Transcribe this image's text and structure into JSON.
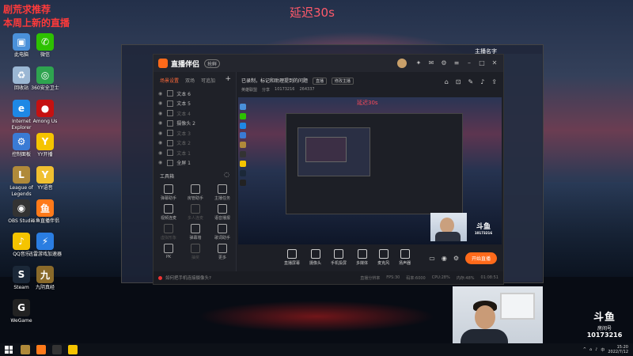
{
  "overlay": {
    "delay_title": "延迟30s",
    "top_left_line1": "剧荒求推荐",
    "top_left_line2": "本周上新的直播"
  },
  "desktop_icons": [
    {
      "label": "此电脑",
      "icon": "computer-icon",
      "color": "#4a90d9",
      "glyph": "▣"
    },
    {
      "label": "回收站",
      "icon": "recycle-bin-icon",
      "color": "#9bb7d4",
      "glyph": "♻"
    },
    {
      "label": "Internet Explorer",
      "icon": "ie-icon",
      "color": "#1e88e5",
      "glyph": "e"
    },
    {
      "label": "控制面板",
      "icon": "control-panel-icon",
      "color": "#3a7bd5",
      "glyph": "⚙"
    },
    {
      "label": "League of Legends",
      "icon": "lol-icon",
      "color": "#b08a3a",
      "glyph": "L"
    },
    {
      "label": "OBS Studio",
      "icon": "obs-icon",
      "color": "#333",
      "glyph": "◉"
    },
    {
      "label": "QQ音乐",
      "icon": "qq-music-icon",
      "color": "#f5c400",
      "glyph": "♪"
    },
    {
      "label": "Steam",
      "icon": "steam-icon",
      "color": "#1b2838",
      "glyph": "S"
    },
    {
      "label": "WeGame",
      "icon": "wegame-icon",
      "color": "#222",
      "glyph": "G"
    },
    {
      "label": "微信",
      "icon": "wechat-icon",
      "color": "#2dc100",
      "glyph": "✆"
    },
    {
      "label": "360安全卫士",
      "icon": "security-icon",
      "color": "#2ea44f",
      "glyph": "◎"
    },
    {
      "label": "Among Us",
      "icon": "among-us-icon",
      "color": "#c51111",
      "glyph": "●"
    },
    {
      "label": "YY开播",
      "icon": "yy-icon",
      "color": "#f5c400",
      "glyph": "Y"
    },
    {
      "label": "YY语音",
      "icon": "yy-voice-icon",
      "color": "#f0c030",
      "glyph": "Y"
    },
    {
      "label": "斗鱼直播伴侣",
      "icon": "douyu-icon",
      "color": "#ff7a1a",
      "glyph": "鱼"
    },
    {
      "label": "迅雷游戏加速器",
      "icon": "accelerator-icon",
      "color": "#2a7de1",
      "glyph": "⚡"
    },
    {
      "label": "九阴真经",
      "icon": "game-icon",
      "color": "#8a6a2a",
      "glyph": "九"
    }
  ],
  "app": {
    "name": "直播伴侣",
    "beta": "抢鲜",
    "user": "主播名字",
    "left_tabs": [
      "场景设置",
      "双场",
      "可追加"
    ],
    "sources": [
      {
        "label": "文本 6",
        "dim": false
      },
      {
        "label": "文本 5",
        "dim": false
      },
      {
        "label": "文本 4",
        "dim": true
      },
      {
        "label": "摄像头 2",
        "dim": false
      },
      {
        "label": "文本 3",
        "dim": true
      },
      {
        "label": "文本 2",
        "dim": true
      },
      {
        "label": "文本 1",
        "dim": true
      },
      {
        "label": "全屏 1",
        "dim": false
      }
    ],
    "toolbox_label": "工具箱",
    "tools": [
      {
        "label": "弹幕助手",
        "dim": false
      },
      {
        "label": "房管助手",
        "dim": false
      },
      {
        "label": "主播任务",
        "dim": false
      },
      {
        "label": "视频连麦",
        "dim": false
      },
      {
        "label": "多人连麦",
        "dim": true
      },
      {
        "label": "语音播报",
        "dim": false
      },
      {
        "label": "虚拟形象",
        "dim": true
      },
      {
        "label": "弹幕墙",
        "dim": false
      },
      {
        "label": "歌词助手",
        "dim": false
      },
      {
        "label": "PK",
        "dim": false
      },
      {
        "label": "抽奖",
        "dim": true
      },
      {
        "label": "更多",
        "dim": false
      }
    ],
    "room_title": "已录制，标记和助理提到的问题",
    "room_chip1": "直播",
    "room_chip2": "修改主播",
    "room_meta": [
      "英雄联盟",
      "分享",
      "10173216",
      "264337"
    ],
    "preview_delay": "延迟30s",
    "bottom_tools": [
      "直播屏幕",
      "摄像头",
      "手机投屏",
      "多媒体",
      "麦克风",
      "扬声器"
    ],
    "start_button": "开始直播",
    "announcement": "如何把手机连接摄像头?",
    "stats": [
      "直播分辨率",
      "FPS:30",
      "码率:6000",
      "CPU:28%",
      "内存:48%",
      "01:08:51"
    ]
  },
  "badge": {
    "logo": "斗鱼",
    "room_label": "房间号",
    "room_number": "10173216"
  },
  "taskbar": {
    "time": "15:20",
    "date": "2022/7/12",
    "lang": "中"
  }
}
